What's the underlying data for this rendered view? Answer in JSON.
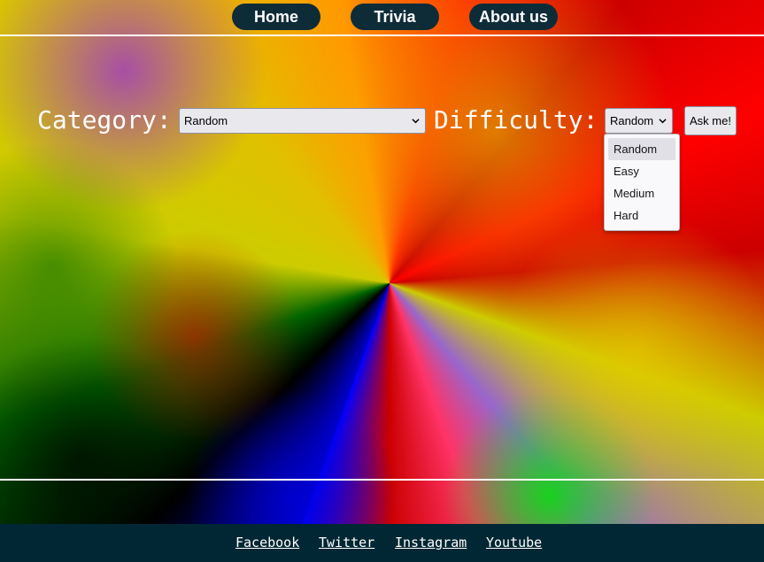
{
  "nav": {
    "home": "Home",
    "trivia": "Trivia",
    "about": "About us"
  },
  "form": {
    "category_label": "Category:",
    "category_value": "Random",
    "difficulty_label": "Difficulty:",
    "difficulty_value": "Random",
    "ask_label": "Ask me!",
    "difficulty_options": [
      "Random",
      "Easy",
      "Medium",
      "Hard"
    ],
    "difficulty_highlighted": "Random"
  },
  "footer": {
    "links": [
      "Facebook",
      "Twitter",
      "Instagram",
      "Youtube"
    ]
  },
  "colors": {
    "nav_button_bg": "#0e2b38",
    "footer_bg": "#002733",
    "text": "#ffffff"
  }
}
